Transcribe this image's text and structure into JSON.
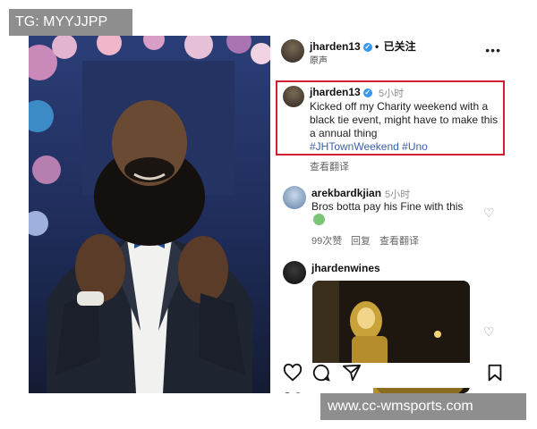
{
  "watermark": {
    "top_left": "TG: MYYJJPP",
    "bottom_right": "www.cc-wmsports.com"
  },
  "post": {
    "header": {
      "username": "jharden13",
      "follow_label": "已关注",
      "separator": "•",
      "audio_label": "原声",
      "more_icon": "more-options-icon"
    },
    "caption": {
      "username": "jharden13",
      "time": "5小时",
      "text": "Kicked off my Charity weekend with a black tie event, might have to make this a annual thing",
      "hashtags": "#JHTownWeekend #Uno",
      "translate_label": "查看翻译"
    },
    "comments": [
      {
        "username": "arekbardkjian",
        "time": "5小时",
        "text": "Bros botta pay his Fine with this",
        "emoji": "crying-laughing-emoji",
        "likes": "99次赞",
        "reply_label": "回复",
        "translate_label": "查看翻译"
      },
      {
        "username": "jhardenwines"
      }
    ],
    "actions": [
      "heart-icon",
      "comment-icon",
      "share-icon",
      "bookmark-icon"
    ]
  },
  "colors": {
    "highlight_border": "#d21f2f",
    "hashtag": "#3b5fa7",
    "verified": "#3897f0",
    "watermark_bg": "#8e8e8e"
  }
}
